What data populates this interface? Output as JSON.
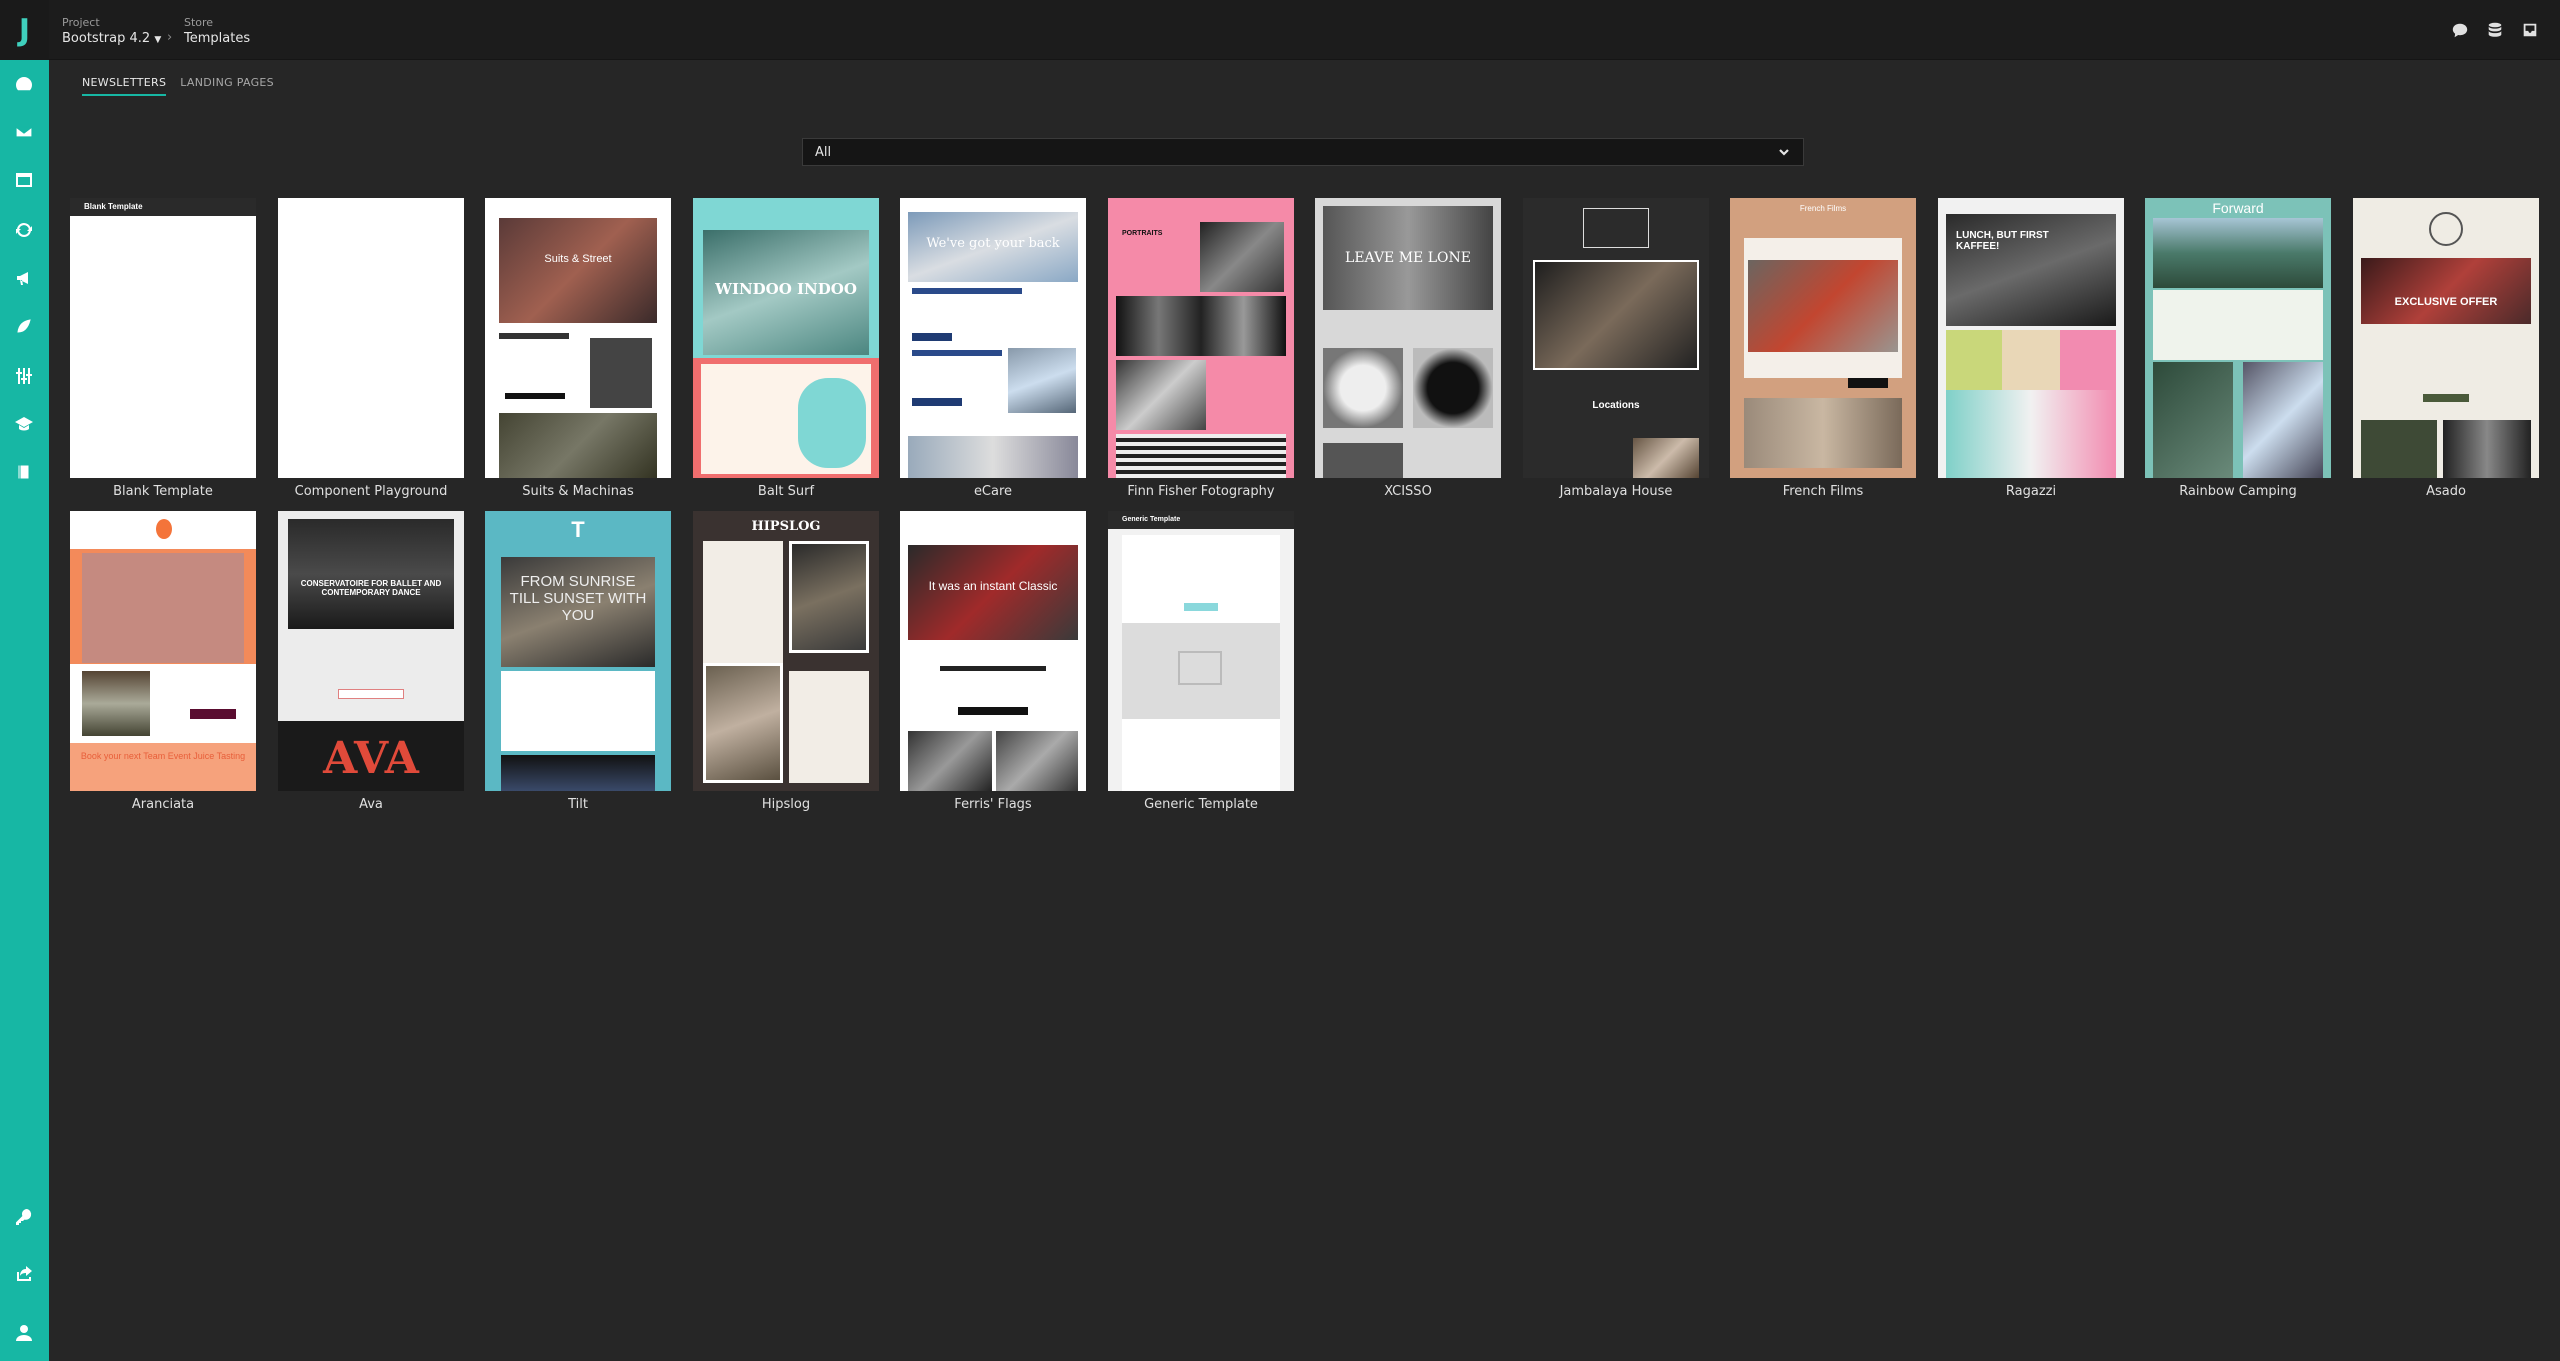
{
  "app": {
    "logo_letter": "J"
  },
  "header": {
    "project_label": "Project",
    "project_value": "Bootstrap 4.2",
    "store_label": "Store",
    "store_value": "Templates"
  },
  "tabs": [
    {
      "label": "NEWSLETTERS",
      "active": true
    },
    {
      "label": "LANDING PAGES",
      "active": false
    }
  ],
  "filter": {
    "selected": "All"
  },
  "sidebar": {
    "items": [
      {
        "icon": "dashboard-icon"
      },
      {
        "icon": "mail-icon"
      },
      {
        "icon": "window-icon"
      },
      {
        "icon": "sync-icon"
      },
      {
        "icon": "megaphone-icon"
      },
      {
        "icon": "plant-icon"
      },
      {
        "icon": "sliders-icon"
      },
      {
        "icon": "graduation-cap-icon"
      },
      {
        "icon": "book-icon"
      },
      {
        "icon": "key-icon"
      },
      {
        "icon": "share-icon"
      },
      {
        "icon": "user-icon"
      }
    ]
  },
  "topbar_icons": [
    "chat-icon",
    "database-icon",
    "inbox-icon"
  ],
  "templates": {
    "row1": [
      {
        "name": "Blank Template",
        "thumb_text": "Blank Template"
      },
      {
        "name": "Component Playground",
        "thumb_text": ""
      },
      {
        "name": "Suits & Machinas",
        "thumb_text": "Suits & Street"
      },
      {
        "name": "Balt Surf",
        "thumb_text": "WINDOO INDOO"
      },
      {
        "name": "eCare",
        "thumb_text": "We've got your back"
      },
      {
        "name": "Finn Fisher Fotography",
        "thumb_text": "PORTRAITS"
      },
      {
        "name": "XCISSO",
        "thumb_text": "LEAVE ME LONE"
      },
      {
        "name": "Jambalaya House",
        "thumb_text": "Locations"
      },
      {
        "name": "French Films",
        "thumb_text": "French Films"
      },
      {
        "name": "Ragazzi",
        "thumb_text": "LUNCH, BUT FIRST KAFFEE!"
      },
      {
        "name": "Rainbow Camping",
        "thumb_text": "Forward"
      },
      {
        "name": "Asado",
        "thumb_text": "EXCLUSIVE OFFER"
      }
    ],
    "row2": [
      {
        "name": "Aranciata",
        "thumb_text": "Book your next Team Event Juice Tasting"
      },
      {
        "name": "Ava",
        "thumb_text": "CONSERVATOIRE FOR BALLET AND CONTEMPORARY DANCE"
      },
      {
        "name": "Tilt",
        "thumb_text": "FROM SUNRISE TILL SUNSET WITH YOU"
      },
      {
        "name": "Hipslog",
        "thumb_text": "HIPSLOG"
      },
      {
        "name": "Ferris' Flags",
        "thumb_text": "It was an instant Classic"
      },
      {
        "name": "Generic Template",
        "thumb_text": "Generic Template"
      }
    ]
  },
  "colors": {
    "accent": "#17b7a4",
    "background": "#262626",
    "topbar": "#1c1c1c"
  }
}
